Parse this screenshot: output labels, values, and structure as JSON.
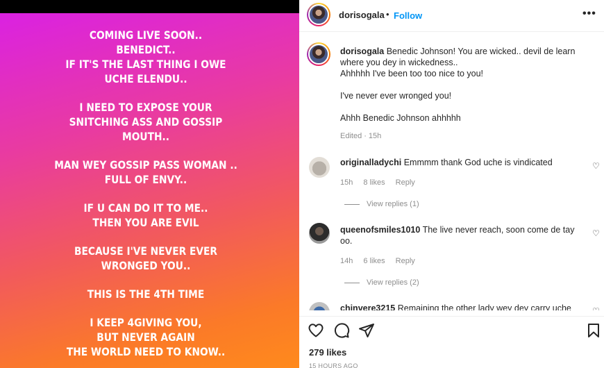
{
  "story": {
    "paragraphs": [
      [
        "COMING LIVE SOON..",
        "BENEDICT..",
        "IF IT'S THE LAST THING I OWE",
        "UCHE ELENDU.."
      ],
      [
        "I NEED TO EXPOSE YOUR",
        "SNITCHING ASS AND GOSSIP",
        "MOUTH.."
      ],
      [
        "MAN WEY GOSSIP PASS WOMAN ..",
        "FULL OF ENVY.."
      ],
      [
        "IF U CAN DO IT TO ME..",
        "THEN YOU ARE EVIL"
      ],
      [
        "BECAUSE I'VE NEVER EVER",
        "WRONGED YOU.."
      ],
      [
        "THIS IS THE 4TH TIME"
      ],
      [
        "I KEEP 4GIVING YOU,",
        "BUT NEVER AGAIN",
        "THE WORLD NEED TO KNOW.."
      ]
    ]
  },
  "header": {
    "username": "dorisogala",
    "separator": "•",
    "follow_label": "Follow",
    "more_label": "•••"
  },
  "caption": {
    "username": "dorisogala",
    "line1": "Benedic Johnson! You are wicked.. devil de learn where you dey in wickedness..",
    "line2": "Ahhhhh I've been too too nice to you!",
    "line3": "I've never ever wronged you!",
    "line4": "Ahhh Benedic Johnson ahhhhh",
    "edited": "Edited",
    "sep": "·",
    "time": "15h"
  },
  "comments": [
    {
      "username": "originalladychi",
      "text": "Emmmm thank God uche is vindicated",
      "time": "15h",
      "likes": "8 likes",
      "reply": "Reply",
      "view_replies": "View replies (1)"
    },
    {
      "username": "queenofsmiles1010",
      "text": "The live never reach, soon come de tay oo.",
      "time": "14h",
      "likes": "6 likes",
      "reply": "Reply",
      "view_replies": "View replies (2)"
    },
    {
      "username": "chinvere3215",
      "text": "Remaining the other lady wey dey carry uche"
    }
  ],
  "footer": {
    "likes": "279 likes",
    "posted": "15 HOURS AGO"
  },
  "icons": {
    "heart": "heart-icon",
    "comment": "comment-icon",
    "share": "share-icon",
    "save": "bookmark-icon"
  }
}
